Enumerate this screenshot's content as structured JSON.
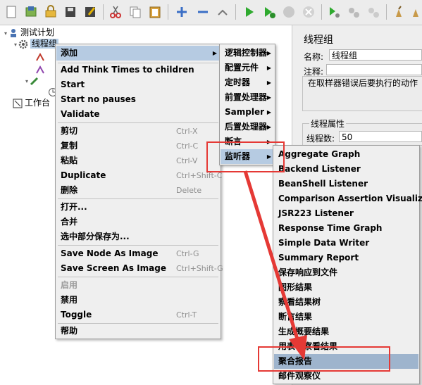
{
  "toolbar": {
    "icons": [
      "new-icon",
      "templates-icon",
      "open-icon",
      "save-icon",
      "save-as-icon",
      "cut-icon",
      "copy-icon",
      "paste-icon",
      "expand-icon",
      "collapse-icon",
      "toggle-icon",
      "start-icon",
      "start-no-pause-icon",
      "stop-icon",
      "shutdown-icon",
      "remote-start-icon",
      "remote-stop-icon",
      "remote-exit-icon",
      "clear-icon",
      "clear-all-icon"
    ]
  },
  "tree": {
    "test_plan": "测试计划",
    "thread_group": "线程组",
    "workbench": "工作台"
  },
  "right_panel": {
    "title": "线程组",
    "name_label": "名称:",
    "name_value": "线程组",
    "comment_label": "注释:",
    "error_action": "在取样器错误后要执行的动作",
    "props_title": "线程属性",
    "threads_label": "线程数:",
    "threads_value": "50"
  },
  "context_menu": {
    "items": [
      {
        "label": "添加",
        "shortcut": "",
        "submenu": true
      },
      {
        "label": "Add Think Times to children",
        "shortcut": ""
      },
      {
        "label": "Start",
        "shortcut": ""
      },
      {
        "label": "Start no pauses",
        "shortcut": ""
      },
      {
        "label": "Validate",
        "shortcut": ""
      },
      {
        "label": "剪切",
        "shortcut": "Ctrl-X"
      },
      {
        "label": "复制",
        "shortcut": "Ctrl-C"
      },
      {
        "label": "粘贴",
        "shortcut": "Ctrl-V"
      },
      {
        "label": "Duplicate",
        "shortcut": "Ctrl+Shift-C"
      },
      {
        "label": "删除",
        "shortcut": "Delete"
      },
      {
        "label": "打开...",
        "shortcut": ""
      },
      {
        "label": "合并",
        "shortcut": ""
      },
      {
        "label": "选中部分保存为...",
        "shortcut": ""
      },
      {
        "label": "Save Node As Image",
        "shortcut": "Ctrl-G"
      },
      {
        "label": "Save Screen As Image",
        "shortcut": "Ctrl+Shift-G"
      },
      {
        "label": "启用",
        "shortcut": ""
      },
      {
        "label": "禁用",
        "shortcut": ""
      },
      {
        "label": "Toggle",
        "shortcut": "Ctrl-T"
      },
      {
        "label": "帮助",
        "shortcut": ""
      }
    ]
  },
  "add_submenu": {
    "items": [
      "逻辑控制器",
      "配置元件",
      "定时器",
      "前置处理器",
      "Sampler",
      "后置处理器",
      "断言",
      "监听器"
    ]
  },
  "listener_submenu": {
    "items": [
      "Aggregate Graph",
      "Backend Listener",
      "BeanShell Listener",
      "Comparison Assertion Visualizer",
      "JSR223 Listener",
      "Response Time Graph",
      "Simple Data Writer",
      "Summary Report",
      "保存响应到文件",
      "图形结果",
      "察看结果树",
      "断言结果",
      "生成概要结果",
      "用表格察看结果",
      "聚合报告",
      "邮件观察仪"
    ]
  },
  "colors": {
    "highlight": "#b6cbe2",
    "annotation": "#e53935"
  }
}
